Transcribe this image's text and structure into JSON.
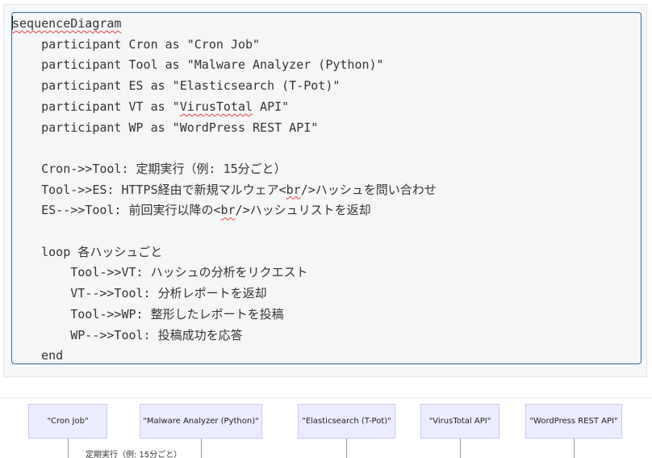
{
  "code_lines": [
    [
      "",
      "sequenceDiagram"
    ],
    [
      "    ",
      "participant Cron as \"Cron Job\""
    ],
    [
      "    ",
      "participant Tool as \"Malware Analyzer (Python)\""
    ],
    [
      "    ",
      "participant ES as \"Elasticsearch (T-Pot)\""
    ],
    [
      "    ",
      "participant VT as \"VirusTotal API\""
    ],
    [
      "    ",
      "participant WP as \"WordPress REST API\""
    ],
    [
      "",
      ""
    ],
    [
      "    ",
      "Cron->>Tool: 定期実行（例: 15分ごと）"
    ],
    [
      "    ",
      "Tool->>ES: HTTPS経由で新規マルウェア<br/>ハッシュを問い合わせ"
    ],
    [
      "    ",
      "ES-->>Tool: 前回実行以降の<br/>ハッシュリストを返却"
    ],
    [
      "",
      ""
    ],
    [
      "    ",
      "loop 各ハッシュごと"
    ],
    [
      "        ",
      "Tool->>VT: ハッシュの分析をリクエスト"
    ],
    [
      "        ",
      "VT-->>Tool: 分析レポートを返却"
    ],
    [
      "        ",
      "Tool->>WP: 整形したレポートを投稿"
    ],
    [
      "        ",
      "WP-->>Tool: 投稿成功を応答"
    ],
    [
      "    ",
      "end"
    ]
  ],
  "diagram": {
    "participants": [
      {
        "id": "cron",
        "label": "\"Cron Job\""
      },
      {
        "id": "tool",
        "label": "\"Malware Analyzer (Python)\""
      },
      {
        "id": "es",
        "label": "\"Elasticsearch (T-Pot)\""
      },
      {
        "id": "vt",
        "label": "\"VirusTotal API\""
      },
      {
        "id": "wp",
        "label": "\"WordPress REST API\""
      }
    ],
    "first_message": "定期実行（例: 15分ごと）"
  }
}
